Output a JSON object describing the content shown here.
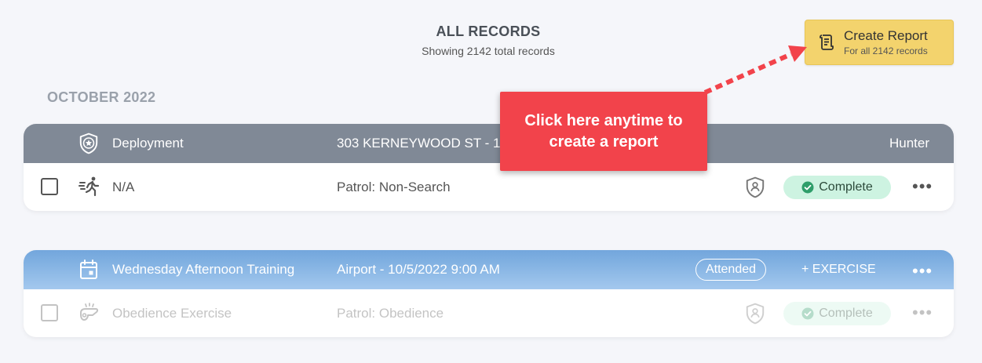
{
  "header": {
    "title": "ALL RECORDS",
    "subtitle": "Showing 2142 total records"
  },
  "create_report": {
    "label": "Create Report",
    "sublabel": "For all 2142 records"
  },
  "month_label": "OCTOBER 2022",
  "callout": {
    "text": "Click here anytime to create a report",
    "color": "#f2434b"
  },
  "records": [
    {
      "type_icon": "police-badge-icon",
      "title": "Deployment",
      "location": "303 KERNEYWOOD ST - 10",
      "handler": "Hunter",
      "row": {
        "activity_icon": "running-person-icon",
        "name": "N/A",
        "category": "Patrol: Non-Search",
        "shield_icon": "shield-user-icon",
        "status": "Complete",
        "menu": "•••"
      },
      "header_color": "#808996"
    },
    {
      "type_icon": "calendar-icon",
      "title": "Wednesday Afternoon Training",
      "location": "Airport - 10/5/2022 9:00 AM",
      "badge": "Attended",
      "add_label": "+ EXERCISE",
      "menu": "•••",
      "row": {
        "activity_icon": "dog-whistle-icon",
        "name": "Obedience Exercise",
        "category": "Patrol: Obedience",
        "shield_icon": "shield-user-icon",
        "status": "Complete",
        "menu": "•••"
      },
      "header_color": "#72a6dc"
    }
  ],
  "colors": {
    "button_bg": "#f3d36d",
    "status_bg": "#cdf3e1",
    "page_bg": "#f5f6fa"
  }
}
